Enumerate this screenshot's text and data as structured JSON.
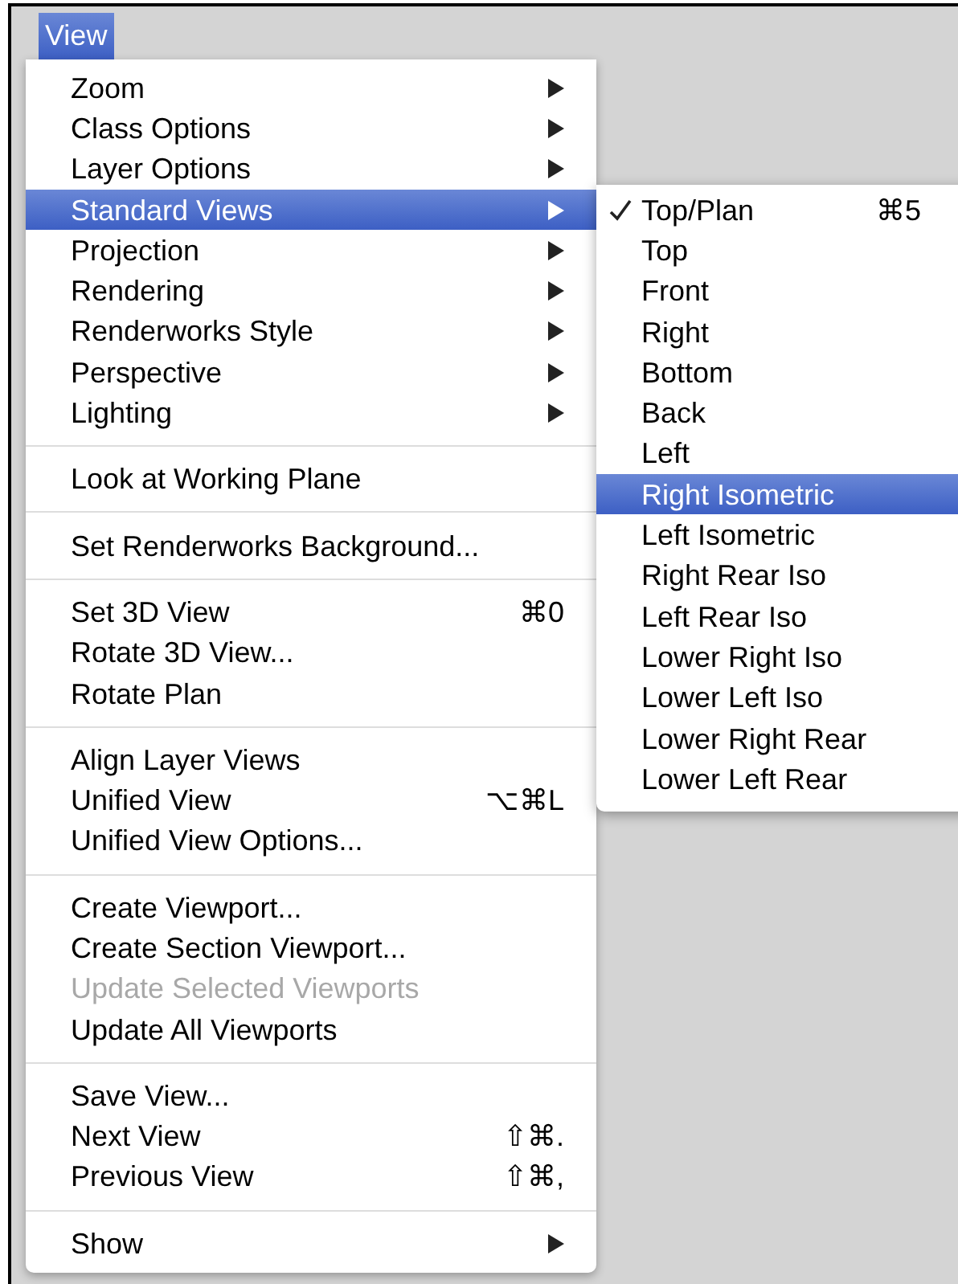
{
  "menu_bar": {
    "title": {
      "label": "View",
      "selected": true
    }
  },
  "menu": {
    "items": [
      {
        "kind": "item",
        "label": "Zoom",
        "submenu": true,
        "selected": false,
        "disabled": false
      },
      {
        "kind": "item",
        "label": "Class Options",
        "submenu": true,
        "selected": false,
        "disabled": false
      },
      {
        "kind": "item",
        "label": "Layer Options",
        "submenu": true,
        "selected": false,
        "disabled": false
      },
      {
        "kind": "item",
        "label": "Standard Views",
        "submenu": true,
        "selected": true,
        "disabled": false
      },
      {
        "kind": "item",
        "label": "Projection",
        "submenu": true,
        "selected": false,
        "disabled": false
      },
      {
        "kind": "item",
        "label": "Rendering",
        "submenu": true,
        "selected": false,
        "disabled": false
      },
      {
        "kind": "item",
        "label": "Renderworks Style",
        "submenu": true,
        "selected": false,
        "disabled": false
      },
      {
        "kind": "item",
        "label": "Perspective",
        "submenu": true,
        "selected": false,
        "disabled": false
      },
      {
        "kind": "item",
        "label": "Lighting",
        "submenu": true,
        "selected": false,
        "disabled": false
      },
      {
        "kind": "separator"
      },
      {
        "kind": "item",
        "label": "Look at Working Plane",
        "submenu": false,
        "selected": false,
        "disabled": false
      },
      {
        "kind": "separator"
      },
      {
        "kind": "item",
        "label": "Set Renderworks Background...",
        "submenu": false,
        "selected": false,
        "disabled": false
      },
      {
        "kind": "separator"
      },
      {
        "kind": "item",
        "label": "Set 3D View",
        "shortcut": "⌘0",
        "submenu": false,
        "selected": false,
        "disabled": false
      },
      {
        "kind": "item",
        "label": "Rotate 3D View...",
        "submenu": false,
        "selected": false,
        "disabled": false
      },
      {
        "kind": "item",
        "label": "Rotate Plan",
        "submenu": false,
        "selected": false,
        "disabled": false
      },
      {
        "kind": "separator"
      },
      {
        "kind": "item",
        "label": "Align Layer Views",
        "submenu": false,
        "selected": false,
        "disabled": false
      },
      {
        "kind": "item",
        "label": "Unified View",
        "shortcut": "⌥⌘L",
        "submenu": false,
        "selected": false,
        "disabled": false
      },
      {
        "kind": "item",
        "label": "Unified View Options...",
        "submenu": false,
        "selected": false,
        "disabled": false
      },
      {
        "kind": "separator"
      },
      {
        "kind": "item",
        "label": "Create Viewport...",
        "submenu": false,
        "selected": false,
        "disabled": false
      },
      {
        "kind": "item",
        "label": "Create Section Viewport...",
        "submenu": false,
        "selected": false,
        "disabled": false
      },
      {
        "kind": "item",
        "label": "Update Selected Viewports",
        "submenu": false,
        "selected": false,
        "disabled": true
      },
      {
        "kind": "item",
        "label": "Update All Viewports",
        "submenu": false,
        "selected": false,
        "disabled": false
      },
      {
        "kind": "separator"
      },
      {
        "kind": "item",
        "label": "Save View...",
        "submenu": false,
        "selected": false,
        "disabled": false
      },
      {
        "kind": "item",
        "label": "Next View",
        "shortcut": "⇧⌘.",
        "submenu": false,
        "selected": false,
        "disabled": false
      },
      {
        "kind": "item",
        "label": "Previous View",
        "shortcut": "⇧⌘,",
        "submenu": false,
        "selected": false,
        "disabled": false
      },
      {
        "kind": "separator"
      },
      {
        "kind": "item",
        "label": "Show",
        "submenu": true,
        "selected": false,
        "disabled": false
      }
    ]
  },
  "submenu": {
    "items": [
      {
        "label": "Top/Plan",
        "shortcut": "⌘5",
        "checked": true,
        "selected": false
      },
      {
        "label": "Top",
        "checked": false,
        "selected": false
      },
      {
        "label": "Front",
        "checked": false,
        "selected": false
      },
      {
        "label": "Right",
        "checked": false,
        "selected": false
      },
      {
        "label": "Bottom",
        "checked": false,
        "selected": false
      },
      {
        "label": "Back",
        "checked": false,
        "selected": false
      },
      {
        "label": "Left",
        "checked": false,
        "selected": false
      },
      {
        "label": "Right Isometric",
        "checked": false,
        "selected": true
      },
      {
        "label": "Left Isometric",
        "checked": false,
        "selected": false
      },
      {
        "label": "Right Rear Iso",
        "checked": false,
        "selected": false
      },
      {
        "label": "Left Rear Iso",
        "checked": false,
        "selected": false
      },
      {
        "label": "Lower Right Iso",
        "checked": false,
        "selected": false
      },
      {
        "label": "Lower Left Iso",
        "checked": false,
        "selected": false
      },
      {
        "label": "Lower Right Rear",
        "checked": false,
        "selected": false
      },
      {
        "label": "Lower Left Rear",
        "checked": false,
        "selected": false
      }
    ]
  }
}
